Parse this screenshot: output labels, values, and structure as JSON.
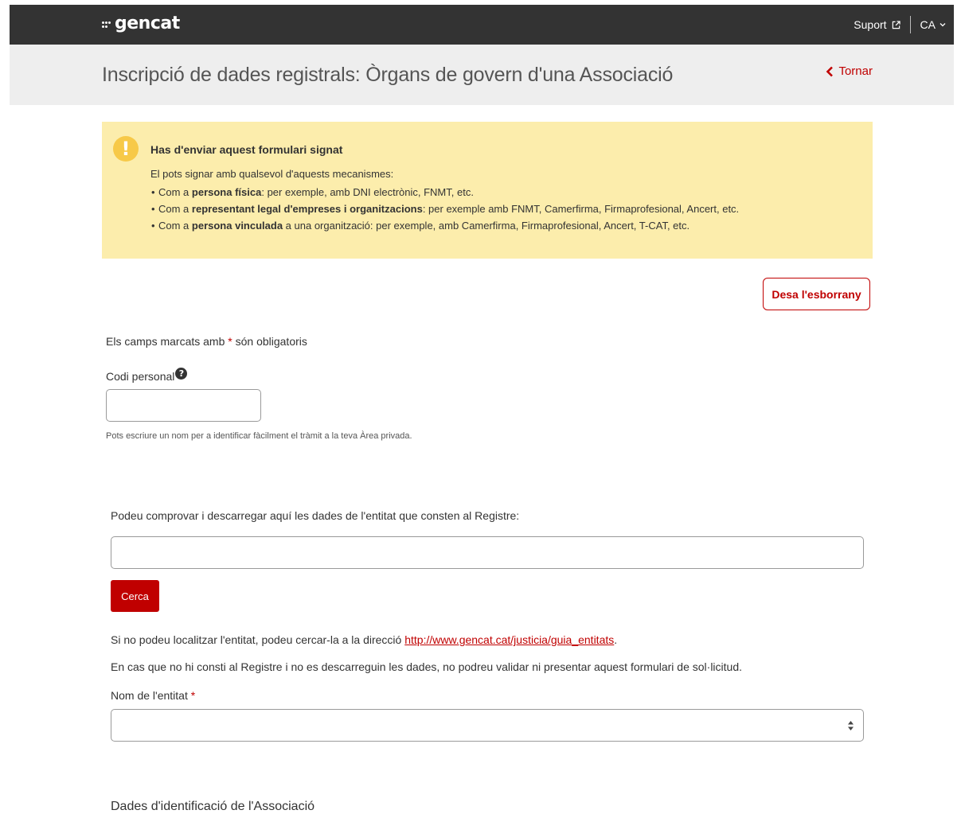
{
  "header": {
    "logo_text": "gencat",
    "support_label": "Suport",
    "language_label": "CA"
  },
  "title_bar": {
    "title": "Inscripció de dades registrals: Òrgans de govern d'una Associació",
    "back_label": "Tornar"
  },
  "alert": {
    "icon_glyph": "!",
    "title": "Has d'enviar aquest formulari signat",
    "intro": "El pots signar amb qualsevol d'aquests mecanismes:",
    "items": [
      {
        "prefix": "Com a ",
        "bold": "persona física",
        "suffix": ": per exemple, amb DNI electrònic, FNMT, etc."
      },
      {
        "prefix": "Com a ",
        "bold": "representant legal d'empreses i organitzacions",
        "suffix": ": per exemple amb FNMT, Camerfirma, Firmaprofesional, Ancert, etc."
      },
      {
        "prefix": "Com a ",
        "bold": "persona vinculada",
        "suffix": " a una organització: per exemple, amb Camerfirma, Firmaprofesional, Ancert, T-CAT, etc."
      }
    ]
  },
  "form": {
    "save_draft_label": "Desa l'esborrany",
    "required_note_before": "Els camps marcats amb ",
    "required_star": "*",
    "required_note_after": " són obligatoris",
    "personal_code_label": "Codi personal",
    "personal_code_value": "",
    "personal_code_hint": "Pots escriure un nom per a identificar fàcilment el tràmit a la teva Àrea privada.",
    "search_prompt": "Podeu comprovar i descarregar aquí les dades de l'entitat que consten al Registre:",
    "search_value": "",
    "search_button_label": "Cerca",
    "locate_text_before": "Si no podeu localitzar l'entitat, podeu cercar-la a la direcció ",
    "locate_link": "http://www.gencat.cat/justicia/guia_entitats",
    "locate_text_after": ".",
    "registry_note": "En cas que no hi consti al Registre i no es descarreguin les dades, no podreu validar ni presentar aquest formulari de sol·licitud.",
    "entity_name_label": "Nom de l'entitat ",
    "entity_name_value": ""
  },
  "section": {
    "title": "Dades d'identificació de l'Associació"
  },
  "colors": {
    "accent_red": "#c00000",
    "topbar": "#333333",
    "alert_background": "#fcedac",
    "warning_icon": "#f7c948"
  }
}
